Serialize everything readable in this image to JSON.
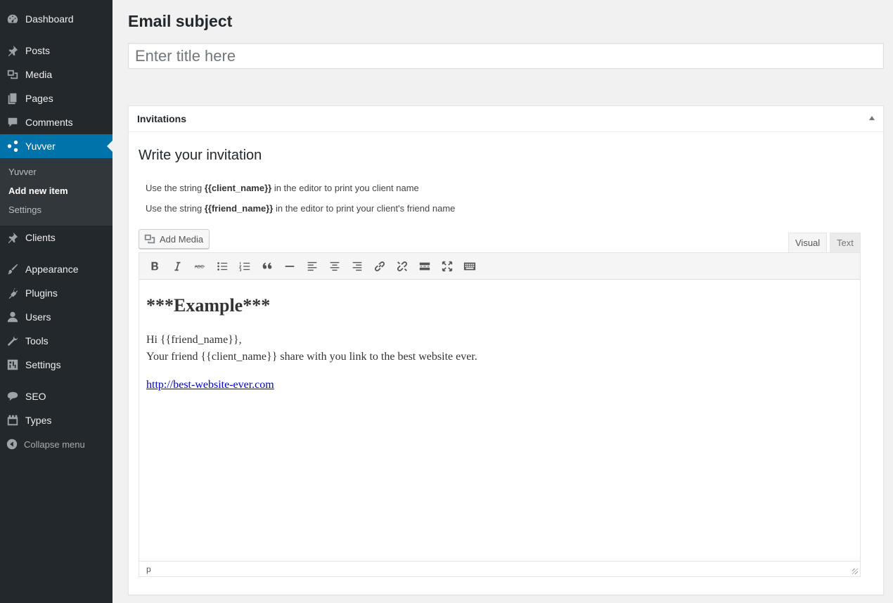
{
  "sidebar": {
    "items": [
      {
        "label": "Dashboard",
        "icon": "dashboard-icon"
      },
      {
        "label": "Posts",
        "icon": "pin-icon"
      },
      {
        "label": "Media",
        "icon": "media-icon"
      },
      {
        "label": "Pages",
        "icon": "pages-icon"
      },
      {
        "label": "Comments",
        "icon": "comment-icon"
      },
      {
        "label": "Yuvver",
        "icon": "share-icon",
        "active": true
      },
      {
        "label": "Clients",
        "icon": "pin-icon"
      },
      {
        "label": "Appearance",
        "icon": "brush-icon"
      },
      {
        "label": "Plugins",
        "icon": "plugin-icon"
      },
      {
        "label": "Users",
        "icon": "user-icon"
      },
      {
        "label": "Tools",
        "icon": "wrench-icon"
      },
      {
        "label": "Settings",
        "icon": "settings-icon"
      },
      {
        "label": "SEO",
        "icon": "seo-icon"
      },
      {
        "label": "Types",
        "icon": "types-icon"
      }
    ],
    "submenu": [
      "Yuvver",
      "Add new item",
      "Settings"
    ],
    "collapse_label": "Collapse menu",
    "accent_color": "#0073aa"
  },
  "title": {
    "heading": "Email subject",
    "placeholder": "Enter title here"
  },
  "postbox": {
    "header": "Invitations",
    "heading": "Write your invitation",
    "hint1": {
      "before": "Use the string ",
      "code": "{{client_name}}",
      "after": " in the editor to print you client name"
    },
    "hint2": {
      "before": "Use the string ",
      "code": "{{friend_name}}",
      "after": " in the editor to print your client's friend name"
    }
  },
  "editor": {
    "add_media_label": "Add Media",
    "tabs": {
      "visual": "Visual",
      "text": "Text"
    },
    "content": {
      "heading": "***Example***",
      "line1": "Hi {{friend_name}},",
      "line2": "Your friend {{client_name}} share with you link to the best website ever.",
      "link": "http://best-website-ever.com"
    },
    "status_path": "p"
  }
}
